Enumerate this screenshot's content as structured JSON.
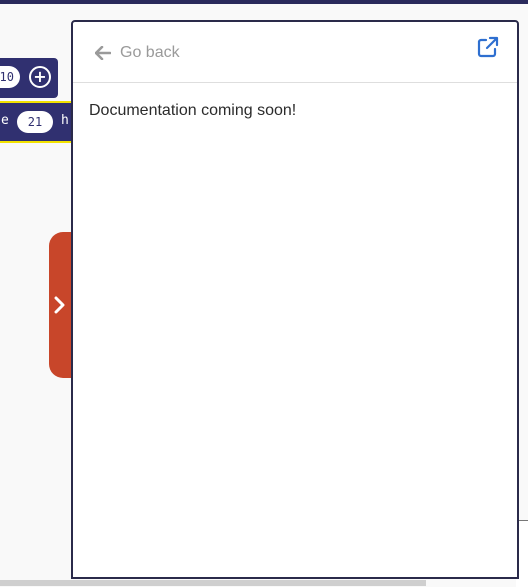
{
  "workspace": {
    "top_block": {
      "number": "10"
    },
    "mid_block": {
      "left_fragment": "e",
      "number": "21",
      "right_fragment": "h"
    }
  },
  "doc_panel": {
    "back_label": "Go back",
    "message": "Documentation coming soon!"
  },
  "colors": {
    "block": "#303070",
    "block_outline": "#f2e200",
    "collapse_tab": "#c8462a",
    "link_icon": "#2e6fd0",
    "muted_text": "#9a9a9a"
  },
  "icons": {
    "back": "arrow-left-icon",
    "external": "external-link-icon",
    "collapse": "chevron-right-icon",
    "add": "plus-circle-icon"
  }
}
